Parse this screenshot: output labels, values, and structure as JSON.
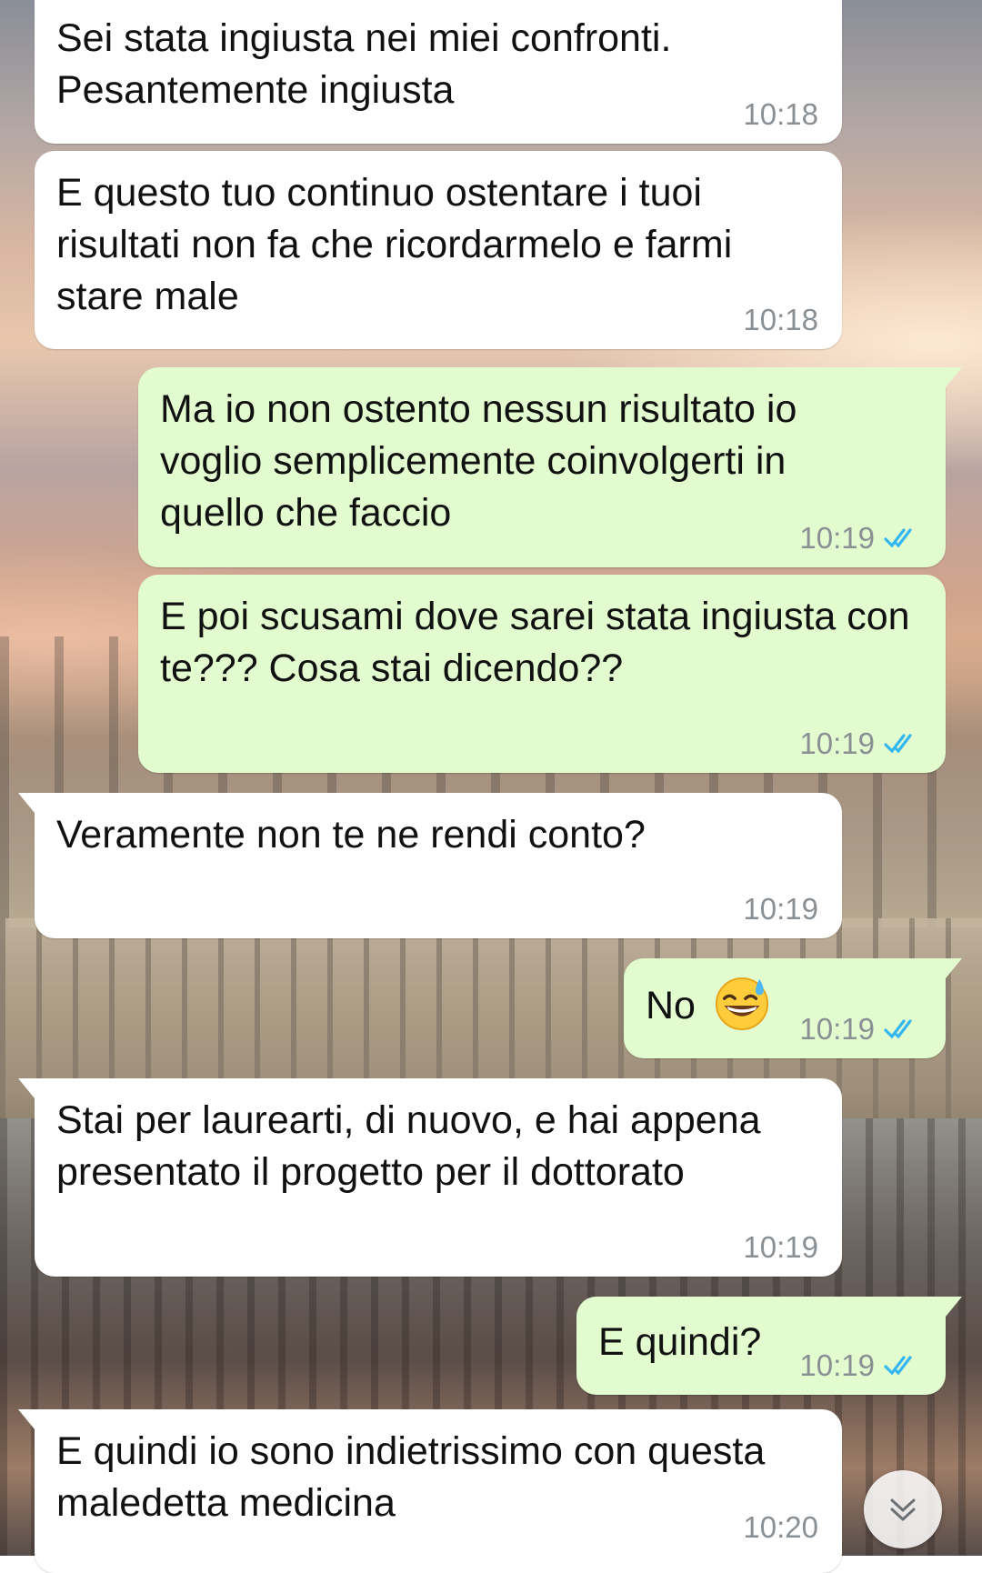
{
  "messages": [
    {
      "direction": "incoming",
      "text": "Sei stata ingiusta nei miei confronti. Pesantemente ingiusta",
      "time": "10:18"
    },
    {
      "direction": "incoming",
      "text": "E questo tuo continuo ostentare i tuoi risultati non fa che ricordarmelo e farmi stare male",
      "time": "10:18"
    },
    {
      "direction": "outgoing",
      "text": "Ma io non ostento nessun risultato io voglio semplicemente coinvolgerti in quello che faccio",
      "time": "10:19",
      "status": "read"
    },
    {
      "direction": "outgoing",
      "text": "E poi scusami dove sarei stata ingiusta con te??? Cosa stai dicendo??",
      "time": "10:19",
      "status": "read"
    },
    {
      "direction": "incoming",
      "text": "Veramente non te ne rendi conto?",
      "time": "10:19"
    },
    {
      "direction": "outgoing",
      "text": "No",
      "emoji": "grinning-face-with-sweat",
      "time": "10:19",
      "status": "read"
    },
    {
      "direction": "incoming",
      "text": "Stai per laurearti, di nuovo, e hai appena presentato il progetto per il dottorato",
      "time": "10:19"
    },
    {
      "direction": "outgoing",
      "text": "E quindi?",
      "time": "10:19",
      "status": "read"
    },
    {
      "direction": "incoming",
      "text": "E quindi io sono indietrissimo con questa maledetta medicina",
      "time": "10:20"
    }
  ],
  "colors": {
    "incoming_bubble": "#ffffff",
    "outgoing_bubble": "#e2fcd0",
    "read_ticks": "#34b7f1",
    "timestamp": "#8a8f93"
  },
  "icons": {
    "read_status": "double-check-icon",
    "scroll_down": "chevron-down-icon"
  }
}
